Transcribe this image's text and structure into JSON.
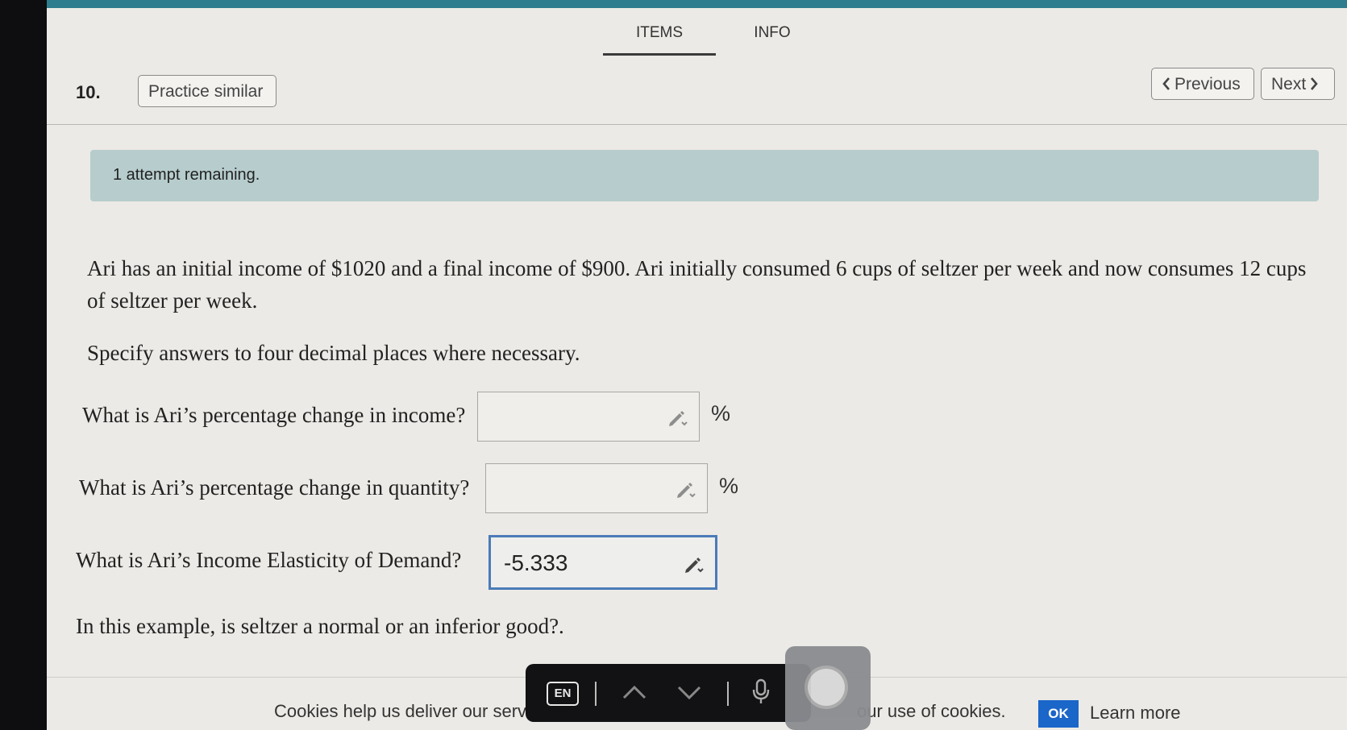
{
  "nav": {
    "tabs": [
      {
        "label": "ITEMS",
        "active": true
      },
      {
        "label": "INFO",
        "active": false
      }
    ],
    "previous_label": "Previous",
    "next_label": "Next"
  },
  "question": {
    "number": "10.",
    "practice_label": "Practice similar",
    "attempts_text": "1 attempt remaining.",
    "prompt": "Ari has an initial income of $1020 and a final income of $900. Ari initially consumed 6 cups of seltzer per week and now consumes 12 cups of seltzer per week.",
    "instruction": "Specify answers to four decimal places where necessary.",
    "parts": [
      {
        "label": "What is Ari’s percentage change in income?",
        "value": "",
        "unit": "%"
      },
      {
        "label": "What is Ari’s percentage change in quantity?",
        "value": "",
        "unit": "%"
      },
      {
        "label": "What is Ari’s Income Elasticity of Demand?",
        "value": "-5.333",
        "unit": ""
      }
    ],
    "followup": "In this example, is seltzer a normal or an inferior good?."
  },
  "cookies": {
    "text_left": "Cookies help us deliver our services.",
    "text_right": "our use of cookies.",
    "ok_label": "OK",
    "learn_more_label": "Learn more"
  },
  "keyboard_toolbar": {
    "language_label": "EN"
  },
  "colors": {
    "top_bar": "#2e7d8f",
    "banner": "#b7cdcd",
    "active_input_border": "#4a7bb8",
    "ok_button": "#1a66c9"
  }
}
